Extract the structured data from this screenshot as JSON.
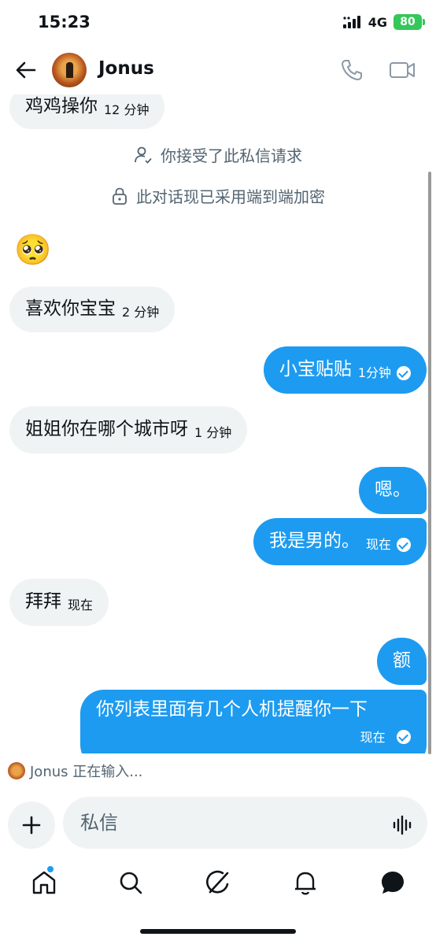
{
  "status_bar": {
    "time": "15:23",
    "network": "4G",
    "battery": "80"
  },
  "header": {
    "contact_name": "Jonus"
  },
  "system": {
    "accepted_request": "你接受了此私信请求",
    "encrypted": "此对话现已采用端到端加密"
  },
  "messages": [
    {
      "direction": "in",
      "text": "鸡鸡操你",
      "time": "12 分钟"
    },
    {
      "direction": "in",
      "text": "🥺",
      "time": ""
    },
    {
      "direction": "in",
      "text": "喜欢你宝宝",
      "time": "2 分钟"
    },
    {
      "direction": "out",
      "text": "小宝贴贴",
      "time": "1分钟",
      "read": true
    },
    {
      "direction": "in",
      "text": "姐姐你在哪个城市呀",
      "time": "1 分钟"
    },
    {
      "direction": "out",
      "text": "嗯。",
      "time": ""
    },
    {
      "direction": "out",
      "text": "我是男的。",
      "time": "现在",
      "read": true
    },
    {
      "direction": "in",
      "text": "拜拜",
      "time": "现在"
    },
    {
      "direction": "out",
      "text": "额",
      "time": ""
    },
    {
      "direction": "out",
      "text": "你列表里面有几个人机提醒你一下",
      "time": "现在",
      "read": true
    }
  ],
  "typing": {
    "text": "Jonus 正在输入..."
  },
  "composer": {
    "placeholder": "私信"
  },
  "colors": {
    "accent": "#1d9bf0",
    "incoming_bubble": "#eff3f4",
    "battery": "#34c759"
  },
  "nav": {
    "items": [
      "home-icon",
      "search-icon",
      "grok-icon",
      "bell-icon",
      "messages-icon"
    ],
    "active": "messages-icon"
  }
}
